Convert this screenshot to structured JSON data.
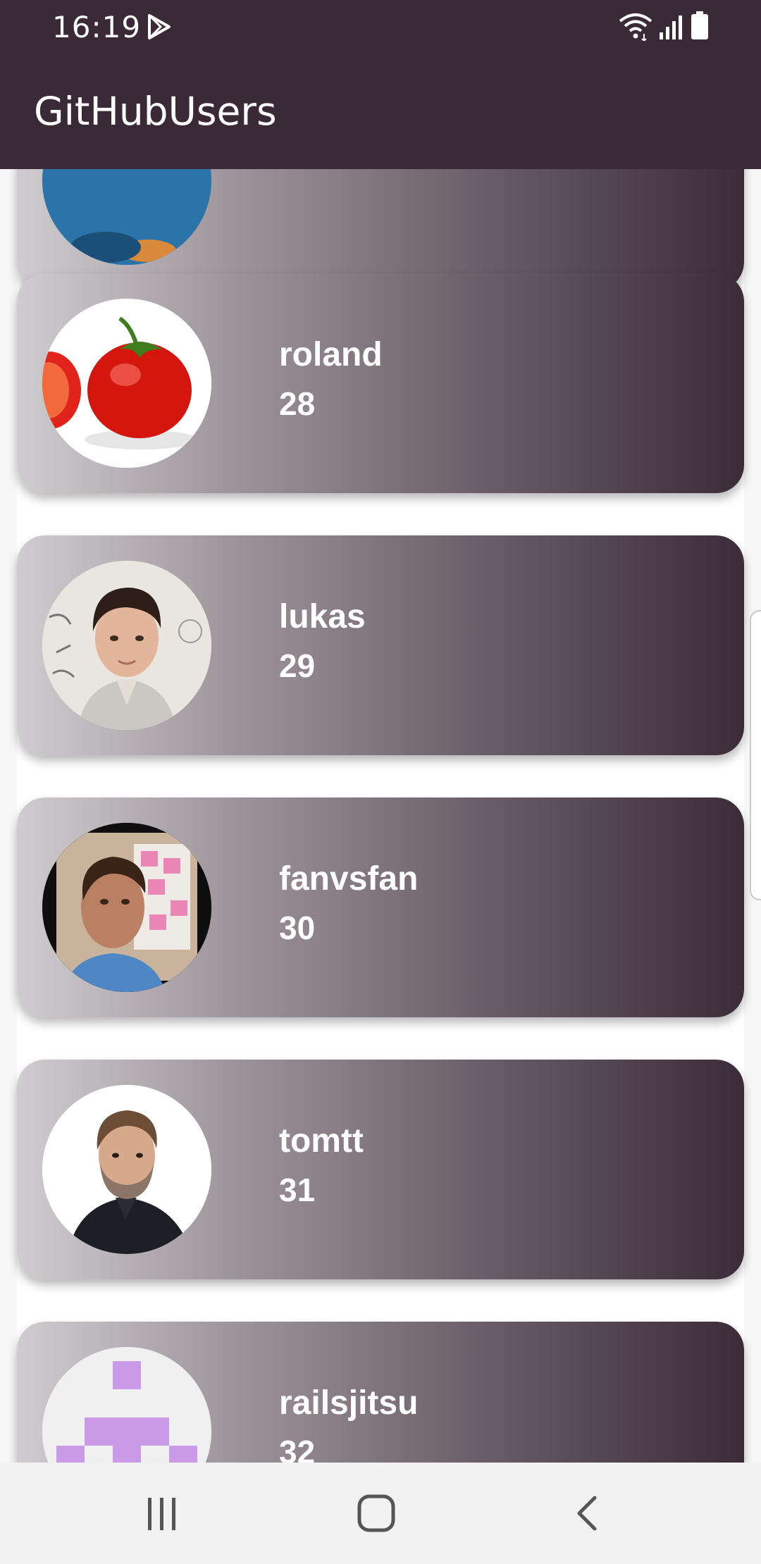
{
  "status_bar": {
    "time": "16:19",
    "icons": [
      "play-store-icon",
      "wifi-icon",
      "signal-icon",
      "battery-icon"
    ]
  },
  "app_bar": {
    "title": "GitHubUsers",
    "background": "#3a2a35"
  },
  "users": [
    {
      "login": "",
      "id": "",
      "avatar": "partial-avatar"
    },
    {
      "login": "roland",
      "id": "28",
      "avatar": "tomato-avatar"
    },
    {
      "login": "lukas",
      "id": "29",
      "avatar": "man-whiteboard-avatar"
    },
    {
      "login": "fanvsfan",
      "id": "30",
      "avatar": "man-sticky-notes-avatar"
    },
    {
      "login": "tomtt",
      "id": "31",
      "avatar": "bearded-man-avatar"
    },
    {
      "login": "railsjitsu",
      "id": "32",
      "avatar": "identicon-avatar"
    }
  ],
  "colors": {
    "card_gradient_start": "#cfcdcf",
    "card_gradient_end": "#3c2c38",
    "identicon": "#c99be6"
  },
  "nav_bar": {
    "icons": [
      "recents-icon",
      "home-icon",
      "back-icon"
    ]
  }
}
